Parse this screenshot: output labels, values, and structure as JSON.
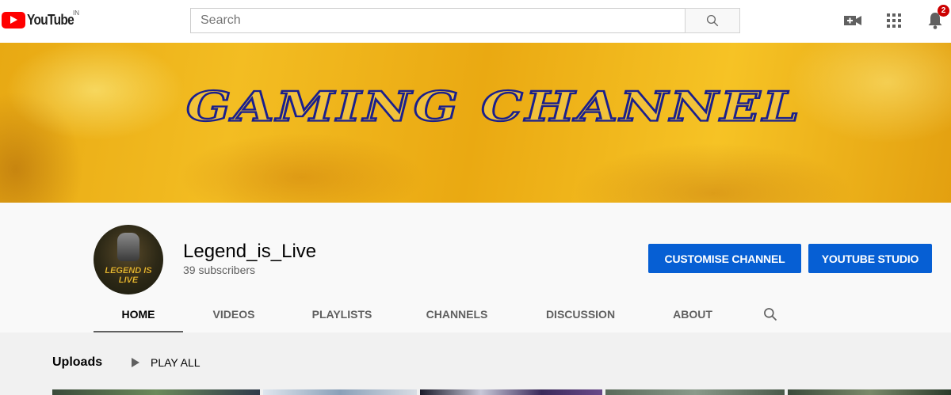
{
  "app": {
    "logo_text": "YouTube",
    "country_code": "IN"
  },
  "search": {
    "placeholder": "Search",
    "value": "",
    "button_icon": "search-icon"
  },
  "topbar_icons": {
    "create": "video-camera-plus-icon",
    "apps": "apps-grid-icon",
    "notifications": "bell-icon",
    "notification_count": "2"
  },
  "banner": {
    "title": "GAMING CHANNEL"
  },
  "channel": {
    "avatar_text": "LEGEND IS LIVE",
    "name": "Legend_is_Live",
    "subscribers": "39 subscribers",
    "customise_label": "CUSTOMISE CHANNEL",
    "studio_label": "YOUTUBE STUDIO"
  },
  "tabs": [
    {
      "label": "HOME",
      "active": true
    },
    {
      "label": "VIDEOS",
      "active": false
    },
    {
      "label": "PLAYLISTS",
      "active": false
    },
    {
      "label": "CHANNELS",
      "active": false
    },
    {
      "label": "DISCUSSION",
      "active": false
    },
    {
      "label": "ABOUT",
      "active": false
    }
  ],
  "uploads": {
    "title": "Uploads",
    "play_all": "PLAY ALL"
  },
  "colors": {
    "brand_red": "#ff0000",
    "button_blue": "#065fd4",
    "banner_gold": "#f0b51e",
    "banner_text_stroke": "#1a1f8c"
  }
}
